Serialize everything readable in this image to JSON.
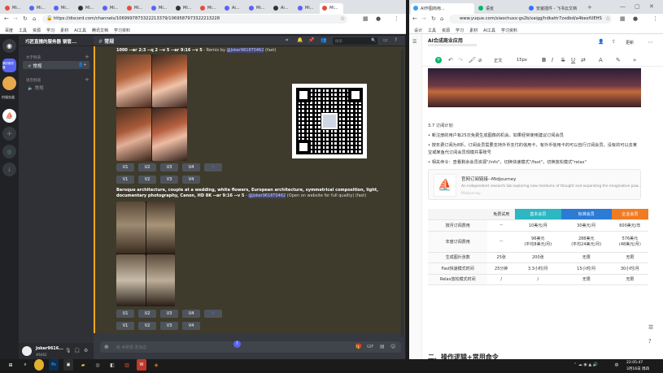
{
  "left_browser": {
    "tabs": [
      "Mi...",
      "Mi...",
      "Mi...",
      "Mi...",
      "Mi...",
      "Mi...",
      "Mi...",
      "Mi...",
      "Mi...",
      "Ai...",
      "Mi...",
      "Ai...",
      "Mi...",
      "Mi..."
    ],
    "url": "https://discord.com/channels/1069997873322213379/1069587973322213228",
    "bookmarks": [
      "百度",
      "工具",
      "资源",
      "学习",
      "素材",
      "AI工具",
      "腾讯文档",
      "学习资料"
    ]
  },
  "discord": {
    "server_name": "巧匠直播的服务器 钢管...",
    "sidebar_label": "我的服务器",
    "category_text": "文字频道",
    "channel_general": "常规",
    "category_voice": "语音频道",
    "channel_voice": "常规",
    "header_channel": "常规",
    "search_placeholder": "搜索",
    "msg1_prompt": "1000 --ar 2:3 --q 2 --v 5 --ar 9:16 --v 5",
    "msg1_suffix": " - Remix by ",
    "msg1_mention": "@Joker9616T0462",
    "msg1_mode": " (fast)",
    "msg2_prompt": "Baroque architecture, couple at a wedding, white flowers, European architecture, symmetrical composition, light, documentary photography, Canon, HD 8K --ar 9:16 --v 5",
    "msg2_dash": " - ",
    "msg2_mention": "@Joker9616T0462",
    "msg2_note": " (Open on website for full quality) (fast)",
    "upscale": [
      "U1",
      "U2",
      "U3",
      "U4"
    ],
    "variation": [
      "V1",
      "V2",
      "V3",
      "V4"
    ],
    "input_placeholder": "给 #常规 发消息",
    "user_name": "Joker9616...",
    "user_status": "#6462"
  },
  "right_browser": {
    "tabs": [
      "AI作图商用...",
      "语雀",
      "安装插件 - 飞书云文档"
    ],
    "url": "www.yuque.com/xiaochuxx-gs2b/xaigg/hdkattr7zxdbd/a4bexfUEHS",
    "bookmarks": [
      "设计",
      "工具",
      "资源",
      "学习",
      "素材",
      "AI工具",
      "学习资料"
    ]
  },
  "yuque": {
    "doc_title": "AI合成商业应用",
    "share_label": "分享",
    "update_label": "更新",
    "toolbar": {
      "body_style": "正文",
      "font_size": "15px"
    },
    "heading_section": "3.7 订阅计划",
    "bullets": [
      "新注册的用户有25次免费生成图像的机会。如果经常使用建议订阅会员",
      "按年费订阅为8折，订阅会员需要支持外币支付的信用卡，有外币信用卡的可以自行订阅会员，没有的可以去某宝或某鱼代订阅会员规模共事账号",
      "相关命令：查看剩余会员资源\"/info\"，切换快速模式\"/fast\"，切换放松模式\"relax\""
    ],
    "link_card": {
      "title": "官网订阅链接--Midjourney",
      "desc": "An independent research lab exploring new mediums of thought and expanding the imaginative pow...",
      "site": "Midjourney"
    },
    "section2": "二、操作逻辑+常用命令"
  },
  "pricing_table": {
    "headers": [
      "",
      "免费试用",
      "基本会员",
      "标准会员",
      "企业会员"
    ],
    "rows": [
      [
        "按月订阅费用",
        "--",
        "10美元/月",
        "30美元/月",
        "600美元/年"
      ],
      [
        "年度订阅费用",
        "--",
        "96美元\n(平均8美元/月)",
        "288美元\n(平均24美元/月)",
        "576美元\n(48美元/月)"
      ],
      [
        "生成图片张数",
        "25张",
        "200张",
        "无限",
        "无限"
      ],
      [
        "Fast快速模式时间",
        "25分钟",
        "3.3小时/月",
        "15小时/月",
        "30小时/月"
      ],
      [
        "Relax放松模式时间",
        "/",
        "/",
        "无限",
        "无限"
      ]
    ]
  },
  "taskbar": {
    "time": "22:05:47",
    "date": "3月16日 周四",
    "lang": "中"
  }
}
